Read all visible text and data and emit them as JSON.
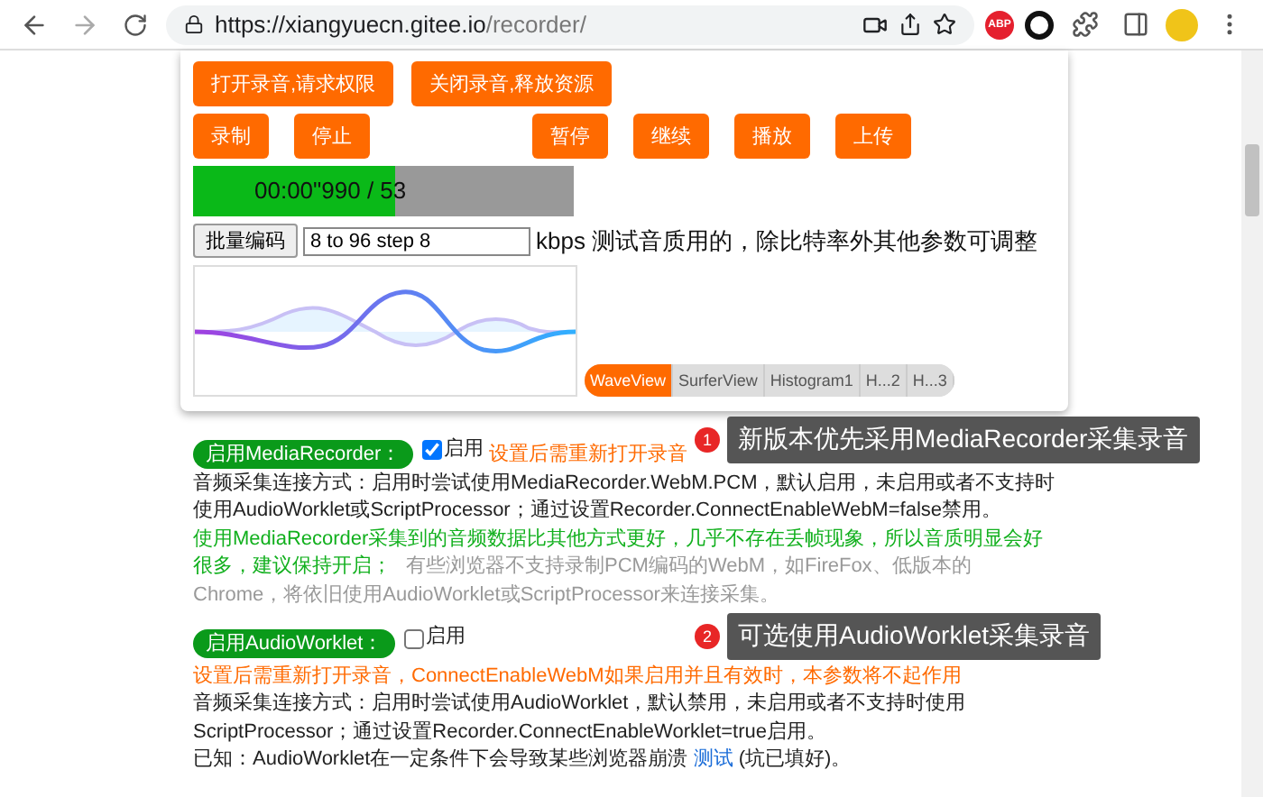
{
  "browser": {
    "url_host": "https://xiangyuecn.gitee.io",
    "url_path": "/recorder/",
    "extension_badge": "ABP"
  },
  "control_rows": [
    {
      "buttons": [
        {
          "label": "打开录音,请求权限"
        },
        {
          "label": "关闭录音,释放资源"
        }
      ]
    },
    {
      "buttons": [
        {
          "label": "录制"
        },
        {
          "label": "停止"
        },
        {
          "label": "暂停"
        },
        {
          "label": "继续"
        },
        {
          "label": "播放"
        },
        {
          "label": "上传"
        }
      ]
    }
  ],
  "progress": {
    "reading": "00:00\"990 / 53",
    "level": 0.53
  },
  "batch": {
    "button": "批量编码",
    "value": "8 to 96 step 8",
    "note": "kbps 测试音质用的，除比特率外其他参数可调整"
  },
  "view_tabs": [
    {
      "label": "WaveView",
      "selected": true
    },
    {
      "label": "SurferView",
      "selected": false
    },
    {
      "label": "Histogram1",
      "selected": false
    },
    {
      "label": "H...2",
      "selected": false
    },
    {
      "label": "H...3",
      "selected": false
    }
  ],
  "options": [
    {
      "badge": "启用MediaRecorder：",
      "checked": true,
      "check_label": "启用",
      "warning": "设置后需重新打开录音",
      "paragraphs": [
        [
          {
            "text": "音频采集连接方式：启用时尝试使用MediaRecorder.WebM.PCM，默认启用，未启用或者不支持时使用AudioWorklet或ScriptProcessor；通过设置Recorder.ConnectEnableWebM=false禁用。",
            "kind": "plain"
          }
        ],
        [
          {
            "text": "使用MediaRecorder采集到的音频数据比其他方式更好，几乎不存在丢帧现象，所以音质明显会好很多，建议保持开启；",
            "kind": "green"
          },
          {
            "text": "有些浏览器不支持录制PCM编码的WebM，如FireFox、低版本的Chrome，将依旧使用AudioWorklet或ScriptProcessor来连接采集。",
            "kind": "muted"
          }
        ]
      ]
    },
    {
      "badge": "启用AudioWorklet：",
      "checked": false,
      "check_label": "启用",
      "warning": "设置后需重新打开录音，ConnectEnableWebM如果启用并且有效时，本参数将不起作用",
      "paragraphs": [
        [
          {
            "text": "音频采集连接方式：启用时尝试使用AudioWorklet，默认禁用，未启用或者不支持时使用ScriptProcessor；通过设置Recorder.ConnectEnableWorklet=true启用。",
            "kind": "plain"
          }
        ],
        [
          {
            "text": "已知：AudioWorklet在一定条件下会导致某些浏览器崩溃",
            "kind": "plain"
          },
          {
            "text": "测试",
            "kind": "link"
          },
          {
            "text": "(坑已填好)。",
            "kind": "plain"
          }
        ]
      ]
    }
  ],
  "callouts": [
    {
      "number": "1",
      "text": "新版本优先采用MediaRecorder采集录音"
    },
    {
      "number": "2",
      "text": "可选使用AudioWorklet采集录音"
    }
  ]
}
